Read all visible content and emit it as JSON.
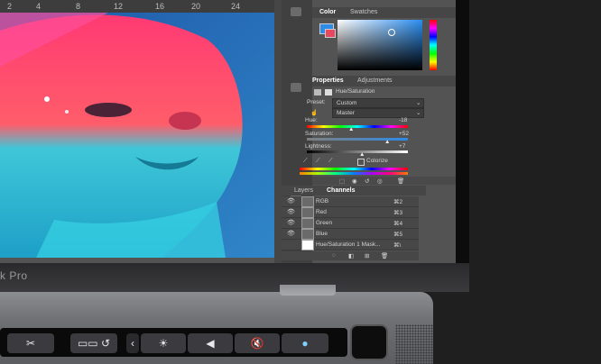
{
  "ruler": {
    "marks": [
      "2",
      "4",
      "8",
      "12",
      "16",
      "20",
      "24"
    ]
  },
  "color_panel": {
    "tabs": [
      "Color",
      "Swatches"
    ],
    "active_tab": "Color"
  },
  "properties": {
    "tabs": [
      "Properties",
      "Adjustments"
    ],
    "adjustment_name": "Hue/Saturation",
    "preset_label": "Preset:",
    "preset_value": "Custom",
    "channel_value": "Master",
    "hue_label": "Hue:",
    "hue_value": "-18",
    "saturation_label": "Saturation:",
    "saturation_value": "+52",
    "lightness_label": "Lightness:",
    "lightness_value": "+7",
    "colorize_label": "Colorize"
  },
  "layers": {
    "tabs": [
      "Layers",
      "Channels"
    ],
    "active_tab": "Channels",
    "channels": [
      {
        "name": "RGB",
        "shortcut": "⌘2"
      },
      {
        "name": "Red",
        "shortcut": "⌘3"
      },
      {
        "name": "Green",
        "shortcut": "⌘4"
      },
      {
        "name": "Blue",
        "shortcut": "⌘5"
      },
      {
        "name": "Hue/Saturation 1 Mask...",
        "shortcut": "⌘\\"
      }
    ]
  },
  "device": {
    "brand_text": "k Pro"
  },
  "touchbar": {
    "buttons": [
      {
        "name": "scissors-icon",
        "glyph": "✂"
      },
      {
        "name": "record-undo",
        "glyph": "▭▭ ↺"
      },
      {
        "name": "collapse-chevron-icon",
        "glyph": "‹"
      },
      {
        "name": "brightness-icon",
        "glyph": "☀"
      },
      {
        "name": "volume-icon",
        "glyph": "◀"
      },
      {
        "name": "mute-icon",
        "glyph": "🔇"
      },
      {
        "name": "siri-icon",
        "glyph": "●"
      }
    ]
  },
  "colors": {
    "accent": "#2d8ae6",
    "panel": "#535353",
    "canvas_bg": "#2b6aa8"
  }
}
